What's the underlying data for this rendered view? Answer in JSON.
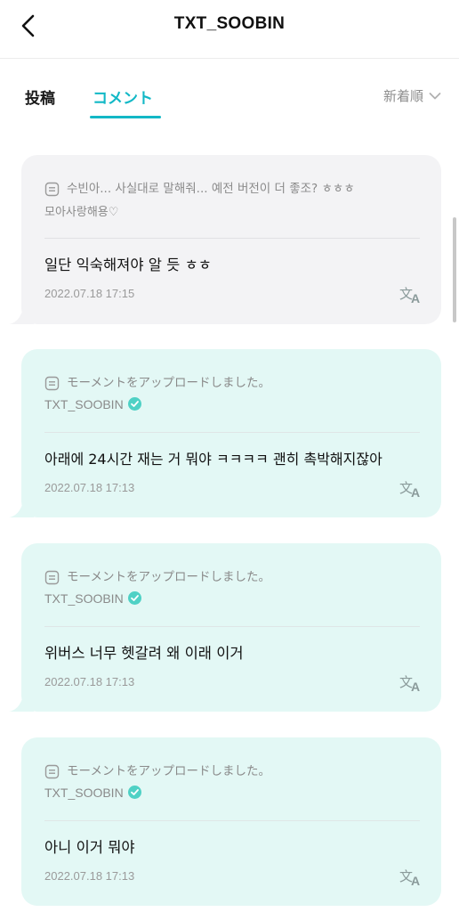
{
  "header": {
    "title": "TXT_SOOBIN",
    "back_icon": "chevron-left-icon"
  },
  "tabs": [
    {
      "label": "投稿",
      "active": false
    },
    {
      "label": "コメント",
      "active": true
    }
  ],
  "sort": {
    "label": "新着順",
    "icon": "chevron-down-icon"
  },
  "colors": {
    "accent": "#12b8c6",
    "card_teal": "#e3f8f5",
    "card_gray": "#f3f3f5",
    "verified": "#4fd1c5"
  },
  "comments": [
    {
      "ref_text": "수빈아... 사실대로 말해줘... 예전 버전이 더 좋조? ㅎㅎㅎ",
      "ref_author": "모아사랑해용♡",
      "text": "일단 익숙해져야 알 듯 ㅎㅎ",
      "date": "2022.07.18 17:15"
    },
    {
      "ref_text": "モーメントをアップロードしました。",
      "ref_author": "TXT_SOOBIN",
      "text": "아래에 24시간 재는 거 뭐야 ㅋㅋㅋㅋ 괜히 촉박해지잖아",
      "date": "2022.07.18 17:13"
    },
    {
      "ref_text": "モーメントをアップロードしました。",
      "ref_author": "TXT_SOOBIN",
      "text": "위버스 너무 헷갈려 왜 이래 이거",
      "date": "2022.07.18 17:13"
    },
    {
      "ref_text": "モーメントをアップロードしました。",
      "ref_author": "TXT_SOOBIN",
      "text": "아니 이거 뭐야",
      "date": "2022.07.18 17:13"
    }
  ]
}
